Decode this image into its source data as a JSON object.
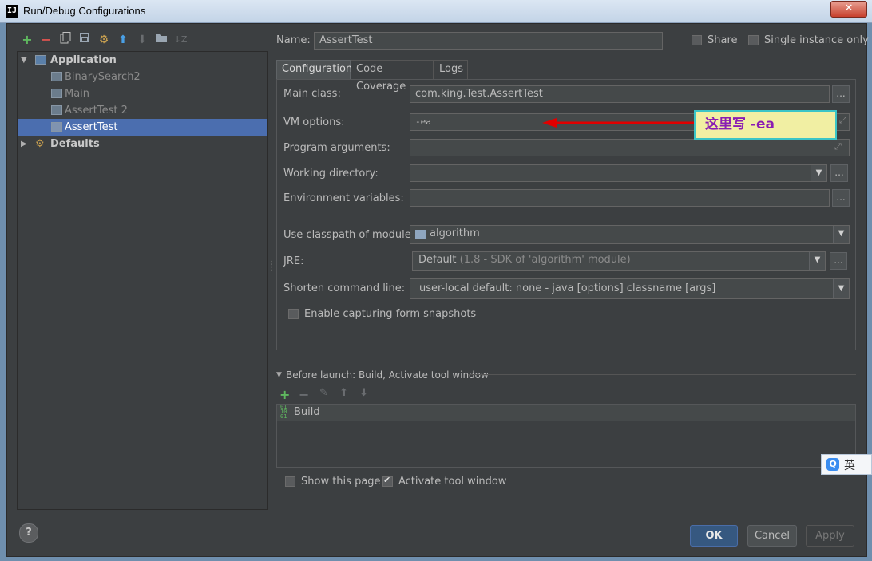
{
  "window": {
    "title": "Run/Debug Configurations",
    "close_glyph": "✕",
    "app_icon_text": "IJ"
  },
  "toolbar": {
    "icons": [
      "add-icon",
      "remove-icon",
      "copy-icon",
      "save-icon",
      "wrench-icon",
      "move-up-icon",
      "move-down-icon",
      "folder-icon",
      "sort-icon"
    ]
  },
  "tree": {
    "application": "Application",
    "items": [
      "BinarySearch2",
      "Main",
      "AssertTest 2",
      "AssertTest"
    ],
    "defaults": "Defaults",
    "selected": "AssertTest"
  },
  "header": {
    "name_label": "Name:",
    "name_value": "AssertTest",
    "share_label": "Share",
    "single_instance_label": "Single instance only"
  },
  "tabs": [
    "Configuration",
    "Code Coverage",
    "Logs"
  ],
  "config": {
    "main_class_label": "Main class:",
    "main_class_value": "com.king.Test.AssertTest",
    "vm_options_label": "VM options:",
    "vm_options_value": "-ea",
    "program_args_label": "Program arguments:",
    "program_args_value": "",
    "working_dir_label": "Working directory:",
    "working_dir_value": "",
    "env_vars_label": "Environment variables:",
    "env_vars_value": "",
    "classpath_label": "Use classpath of module:",
    "classpath_value": "algorithm",
    "jre_label": "JRE:",
    "jre_value": "Default",
    "jre_hint": "(1.8 - SDK of 'algorithm' module)",
    "shorten_label": "Shorten command line:",
    "shorten_value": "user-local default: none - java [options] classname [args]",
    "snapshots_label": "Enable capturing form snapshots"
  },
  "annotation": {
    "text": "这里写 -ea",
    "arrow_color": "#e00000"
  },
  "before_launch": {
    "title": "Before launch: Build, Activate tool window",
    "items": [
      "Build"
    ]
  },
  "options": {
    "show_page_label": "Show this page",
    "show_page_checked": false,
    "activate_label": "Activate tool window",
    "activate_checked": true
  },
  "buttons": {
    "ok": "OK",
    "cancel": "Cancel",
    "apply": "Apply",
    "help": "?",
    "ellipsis": "..."
  },
  "ime": {
    "logo": "Q",
    "lang": "英"
  },
  "colors": {
    "selection": "#4b6eaf",
    "background": "#3c3f41",
    "callout_bg": "#f1efa3",
    "callout_text": "#8a1db3",
    "callout_border": "#3ac5c7"
  }
}
